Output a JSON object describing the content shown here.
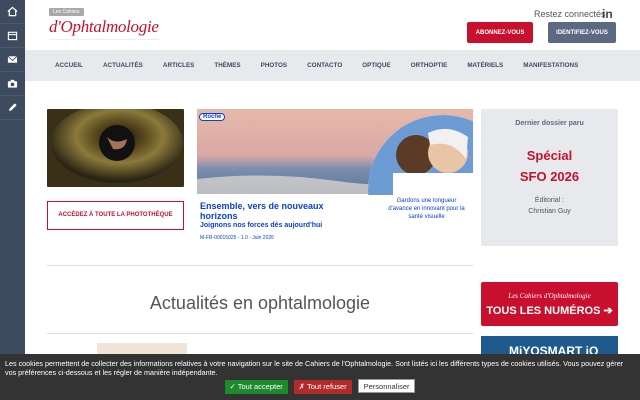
{
  "sidebar": {
    "icons": [
      "home-icon",
      "calendar-icon",
      "mail-icon",
      "camera-icon",
      "pen-icon"
    ]
  },
  "header": {
    "logo_small": "Les Cahiers",
    "logo_big": "d'Ophtalmologie",
    "stay_connected": "Restez connectés",
    "linkedin": "in",
    "subscribe": "ABONNEZ-VOUS",
    "login": "IDENTIFIEZ-VOUS"
  },
  "nav": {
    "items": [
      "ACCUEIL",
      "ACTUALITÉS",
      "ARTICLES",
      "THÈMES",
      "PHOTOS",
      "CONTACTO",
      "OPTIQUE",
      "ORTHOPTIE",
      "MATÉRIELS",
      "MANIFESTATIONS"
    ]
  },
  "photo_button": "ACCÉDEZ À TOUTE LA PHOTOTHÈQUE",
  "ad": {
    "brand": "Roche",
    "headline": "Ensemble, vers de nouveaux horizons",
    "subline": "Joignons nos forces dès aujourd'hui",
    "ref": "M-FR-00015025 - 1.0 - Juin 2026",
    "tagline": "Gardons une longueur d'avance en innovant pour la santé visuelle"
  },
  "dossier": {
    "title": "Dernier dossier paru",
    "name1": "Spécial",
    "name2": "SFO 2026",
    "editorial_label": "Éditorial :",
    "editorial_author": "Christian Guy"
  },
  "section_heading": "Actualités en ophtalmologie",
  "numbers_box": {
    "brand": "Les Cahiers d'Ophtalmologie",
    "label": "TOUS LES NUMÉROS"
  },
  "myosmart": "MiYOSMART iQ",
  "cookie": {
    "text": "Les cookies permettent de collecter des informations relatives à votre navigation sur le site de Cahiers de l'Ophtalmologie. Sont listés ici les différents types de cookies utilisés. Vous pouvez gérer vos préférences ci-dessous et les régler de manière indépendante.",
    "accept": "✓ Tout accepter",
    "refuse": "✗ Tout refuser",
    "customize": "Personnaliser"
  },
  "colors": {
    "brand_red": "#c8102e",
    "sidebar": "#3e4a5e",
    "nav_bg": "#e8e9ec"
  }
}
